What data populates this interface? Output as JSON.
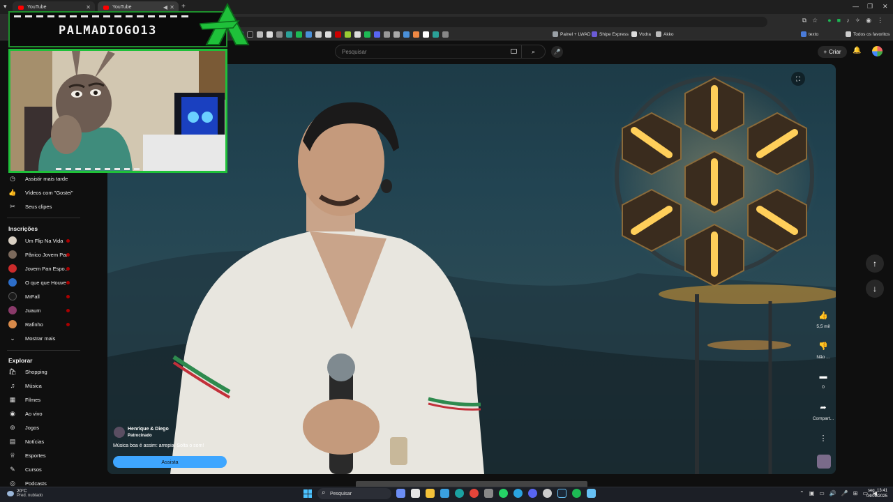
{
  "browser": {
    "tabs": [
      {
        "label": "YouTube"
      },
      {
        "label": "YouTube"
      }
    ],
    "new_tab": "+",
    "bookmarks": [
      {
        "label": "Painel + LWAD",
        "color": "#9aa0a6"
      },
      {
        "label": "Shipe Express",
        "color": "#6b5bd6"
      },
      {
        "label": "Vodra",
        "color": "#dddddd"
      },
      {
        "label": "Akko",
        "color": "#bbbbbb"
      },
      {
        "label": "texto",
        "color": "#4a7bd8"
      },
      {
        "label": "Todos os favoritos",
        "color": "#cccccc"
      }
    ]
  },
  "masthead": {
    "search_placeholder": "Pesquisar",
    "create_label": "Criar"
  },
  "sidebar": {
    "top_items": [
      {
        "label": "Assistir mais tarde",
        "icon": "clock-icon",
        "glyph": "◷"
      },
      {
        "label": "Vídeos com \"Gostei\"",
        "icon": "thumbs-up-icon",
        "glyph": "👍"
      },
      {
        "label": "Seus clipes",
        "icon": "scissors-icon",
        "glyph": "✂"
      }
    ],
    "subscriptions_heading": "Inscrições",
    "subscriptions": [
      {
        "label": "Um Flip Na Vida",
        "color": "#d9d0c3"
      },
      {
        "label": "Pânico Jovem Pan",
        "color": "#7c6a5c"
      },
      {
        "label": "Jovem Pan Espo...",
        "color": "#cc2b2b"
      },
      {
        "label": "O que que Houve",
        "color": "#2d6ec9"
      },
      {
        "label": "MrFall",
        "color": "#1a1a1a"
      },
      {
        "label": "Juaum",
        "color": "#8a3a6a"
      },
      {
        "label": "Rafinho",
        "color": "#d88a4a"
      }
    ],
    "show_more": "Mostrar mais",
    "explore_heading": "Explorar",
    "explore": [
      {
        "label": "Shopping",
        "icon": "shopping-bag-icon",
        "glyph": "🛍"
      },
      {
        "label": "Música",
        "icon": "music-icon",
        "glyph": "♫"
      },
      {
        "label": "Filmes",
        "icon": "film-icon",
        "glyph": "▦"
      },
      {
        "label": "Ao vivo",
        "icon": "live-icon",
        "glyph": "◉"
      },
      {
        "label": "Jogos",
        "icon": "gamepad-icon",
        "glyph": "⊚"
      },
      {
        "label": "Notícias",
        "icon": "news-icon",
        "glyph": "▤"
      },
      {
        "label": "Esportes",
        "icon": "trophy-icon",
        "glyph": "♕"
      },
      {
        "label": "Cursos",
        "icon": "courses-icon",
        "glyph": "✎"
      },
      {
        "label": "Podcasts",
        "icon": "podcast-icon",
        "glyph": "◎"
      }
    ]
  },
  "short_actions": {
    "like_count": "5,5 mil",
    "dislike_label": "Não ...",
    "comments_count": "0",
    "share_label": "Compart..."
  },
  "ad": {
    "channel": "Henrique & Diego",
    "sponsored": "Patrocinado",
    "text": "Música boa é assim: arrepia. Solta o som!",
    "button": "Assista"
  },
  "streamer_overlay": {
    "name": "PALMADIOGO13"
  },
  "taskbar": {
    "temperature": "20°C",
    "weather": "Pred. nublado",
    "search_placeholder": "Pesquisar",
    "time": "13:41",
    "day": "seg.",
    "date": "04/08/2025",
    "apps": [
      {
        "name": "copilot",
        "color": "#6c8ef5"
      },
      {
        "name": "store",
        "color": "#e7e7e7"
      },
      {
        "name": "files",
        "color": "#f3c23a"
      },
      {
        "name": "photos",
        "color": "#3aa0e0"
      },
      {
        "name": "edge",
        "color": "#1ba1a1"
      },
      {
        "name": "chrome",
        "color": "#e5453a"
      },
      {
        "name": "excel",
        "color": "#888888"
      },
      {
        "name": "whatsapp",
        "color": "#25d366"
      },
      {
        "name": "telegram",
        "color": "#2aa3e0"
      },
      {
        "name": "discord",
        "color": "#5865f2"
      },
      {
        "name": "mail",
        "color": "#cccccc"
      },
      {
        "name": "steam",
        "color": "#1b2838"
      },
      {
        "name": "spotify",
        "color": "#1db954"
      },
      {
        "name": "steam2",
        "color": "#66c0f4"
      }
    ]
  }
}
